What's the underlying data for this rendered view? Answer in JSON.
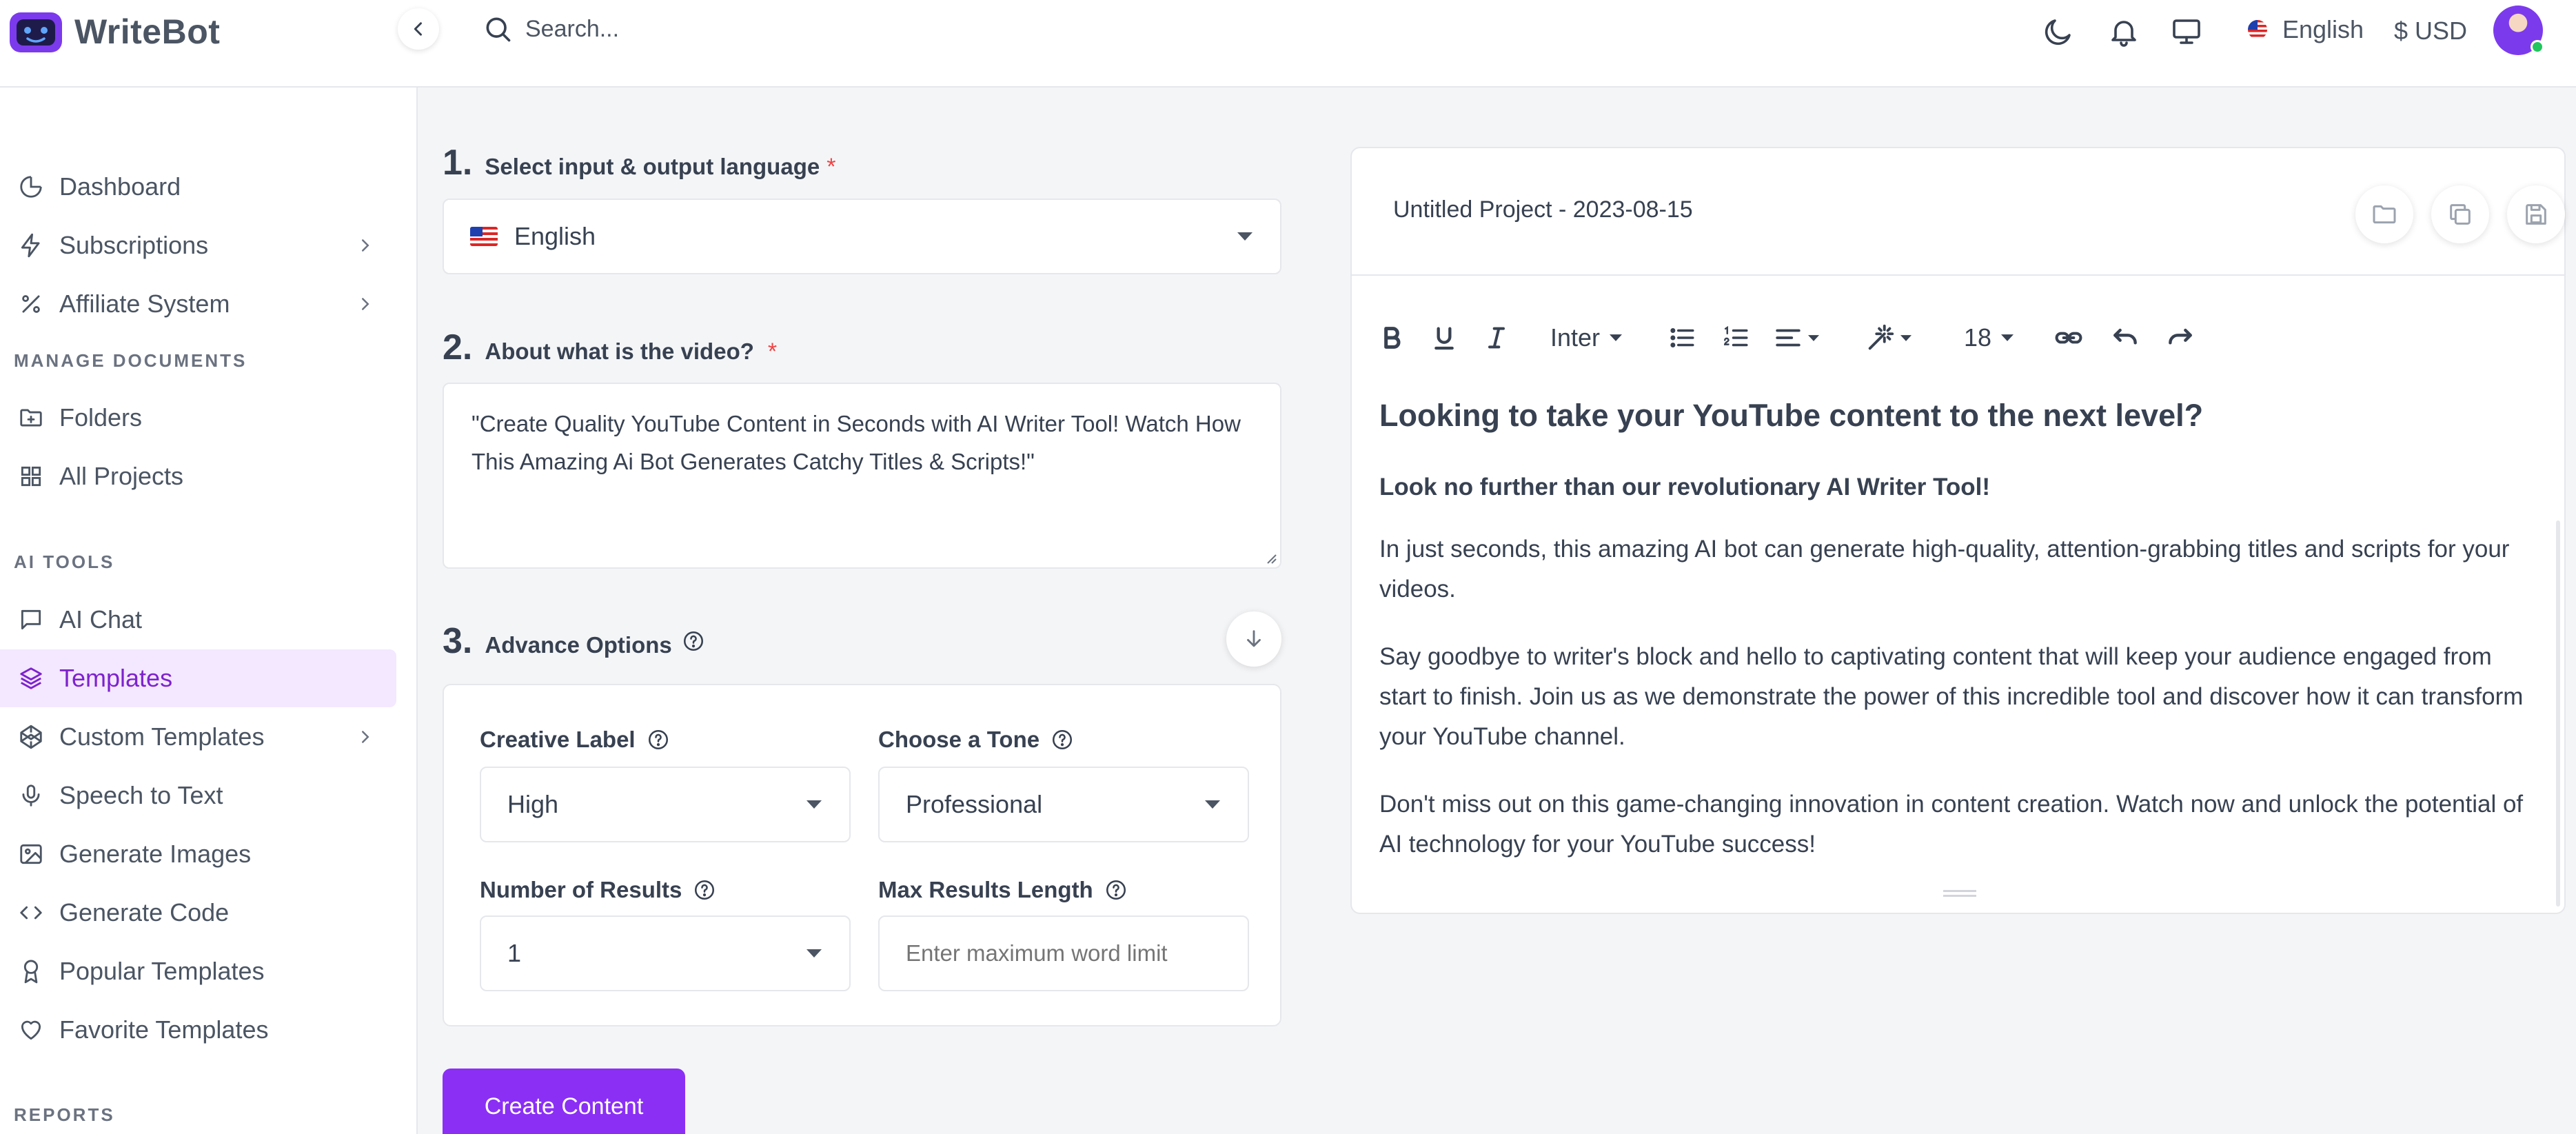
{
  "brand": {
    "name": "WriteBot"
  },
  "search": {
    "placeholder": "Search..."
  },
  "topbar": {
    "language": "English",
    "currency": "$ USD"
  },
  "sidebar": {
    "items_top": [
      {
        "label": "Dashboard",
        "icon": "pie-chart-icon"
      },
      {
        "label": "Subscriptions",
        "icon": "bolt-icon"
      },
      {
        "label": "Affiliate System",
        "icon": "percent-icon"
      }
    ],
    "section_manage": "MANAGE DOCUMENTS",
    "items_manage": [
      {
        "label": "Folders",
        "icon": "folder-plus-icon"
      },
      {
        "label": "All Projects",
        "icon": "grid-icon"
      }
    ],
    "section_ai": "AI TOOLS",
    "items_ai": [
      {
        "label": "AI Chat",
        "icon": "chat-icon"
      },
      {
        "label": "Templates",
        "icon": "layers-icon"
      },
      {
        "label": "Custom Templates",
        "icon": "codepen-icon"
      },
      {
        "label": "Speech to Text",
        "icon": "mic-icon"
      },
      {
        "label": "Generate Images",
        "icon": "image-icon"
      },
      {
        "label": "Generate Code",
        "icon": "code-icon"
      },
      {
        "label": "Popular Templates",
        "icon": "award-icon"
      },
      {
        "label": "Favorite Templates",
        "icon": "heart-icon"
      }
    ],
    "section_reports": "REPORTS"
  },
  "form": {
    "step1": {
      "num": "1.",
      "title": "Select input & output language",
      "required": "*",
      "value": "English"
    },
    "step2": {
      "num": "2.",
      "title": "About what is the video?",
      "required": "*",
      "value": "\"Create Quality YouTube Content in Seconds with AI Writer Tool! Watch How This Amazing Ai Bot Generates Catchy Titles & Scripts!\""
    },
    "step3": {
      "num": "3.",
      "title": "Advance Options"
    },
    "creative_label": {
      "label": "Creative Label",
      "value": "High"
    },
    "tone": {
      "label": "Choose a Tone",
      "value": "Professional"
    },
    "results": {
      "label": "Number of Results",
      "value": "1"
    },
    "max_length": {
      "label": "Max Results Length",
      "placeholder": "Enter maximum word limit"
    },
    "create_label": "Create Content"
  },
  "editor": {
    "project_title": "Untitled Project - 2023-08-15",
    "toolbar": {
      "font": "Inter",
      "size": "18"
    },
    "content": {
      "heading": "Looking to take your YouTube content to the next level?",
      "subheading": "Look no further than our revolutionary AI Writer Tool!",
      "p1": "In just seconds, this amazing AI bot can generate high-quality, attention-grabbing titles and scripts for your videos.",
      "p2": "Say goodbye to writer's block and hello to captivating content that will keep your audience engaged from start to finish. Join us as we demonstrate the power of this incredible tool and discover how it can transform your YouTube channel.",
      "p3": "Don't miss out on this game-changing innovation in content creation. Watch now and unlock the potential of AI technology for your YouTube success!"
    }
  },
  "colors": {
    "accent": "#8b2ff5",
    "active_bg": "#f3e8ff",
    "active_text": "#7e22ce",
    "required": "#ef4444"
  }
}
